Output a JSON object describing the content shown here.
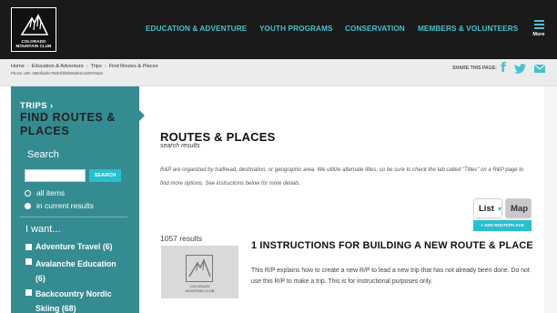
{
  "logo": {
    "line1": "COLORADO",
    "line2": "MOUNTAIN CLUB"
  },
  "nav": {
    "items": [
      "EDUCATION & ADVENTURE",
      "YOUTH PROGRAMS",
      "CONSERVATION",
      "MEMBERS & VOLUNTEERS"
    ],
    "more_label": "More",
    "accent_color": "#47c1cf"
  },
  "breadcrumb": {
    "items": [
      "Home",
      "Education & Adventure",
      "Trips",
      "Find Routes & Places"
    ],
    "phone_uid": "Phone UID: 0894faabc769b4fbf9b06d84e1639765a0",
    "share_label": "SHARE THIS PAGE:",
    "share_icons": [
      "facebook-icon",
      "twitter-icon",
      "email-icon"
    ]
  },
  "sidebar": {
    "section": "TRIPS ›",
    "heading": "FIND ROUTES & PLACES",
    "search_label": "Search",
    "search_button": "SEARCH",
    "search_value": "",
    "radio_options": [
      {
        "label": "all items",
        "checked": false
      },
      {
        "label": "in current results",
        "checked": true
      }
    ],
    "want_label": "I want...",
    "filters": [
      {
        "label": "Adventure Travel",
        "count": "(6)"
      },
      {
        "label": "Avalanche Education",
        "count": "(6)"
      },
      {
        "label": "Backcountry Nordic Skiing",
        "count": "(68)"
      }
    ],
    "color": "#348c91"
  },
  "main": {
    "title": "ROUTES & PLACES",
    "subtitle": "search results",
    "intro": "R&P are organized by trailhead, destination, or geographic area. We utilize alternate titles, so be sure to check the tab called \"Titles\" on a R&P page to find more options. See instructions below for more details.",
    "view_list": "List",
    "view_map": "Map",
    "add_button": "+ ADD ROUTE/PLACE",
    "results_count": "1057 results",
    "results": [
      {
        "title": "1 INSTRUCTIONS FOR BUILDING A NEW ROUTE & PLACE",
        "description": "This R/P explains how to create a new R/P to lead a new trip that has not already been done. Do not use this R/P to make a trip. This is for instructional purposes only.",
        "thumb_line1": "COLORADO",
        "thumb_line2": "MOUNTAIN CLUB"
      }
    ]
  }
}
